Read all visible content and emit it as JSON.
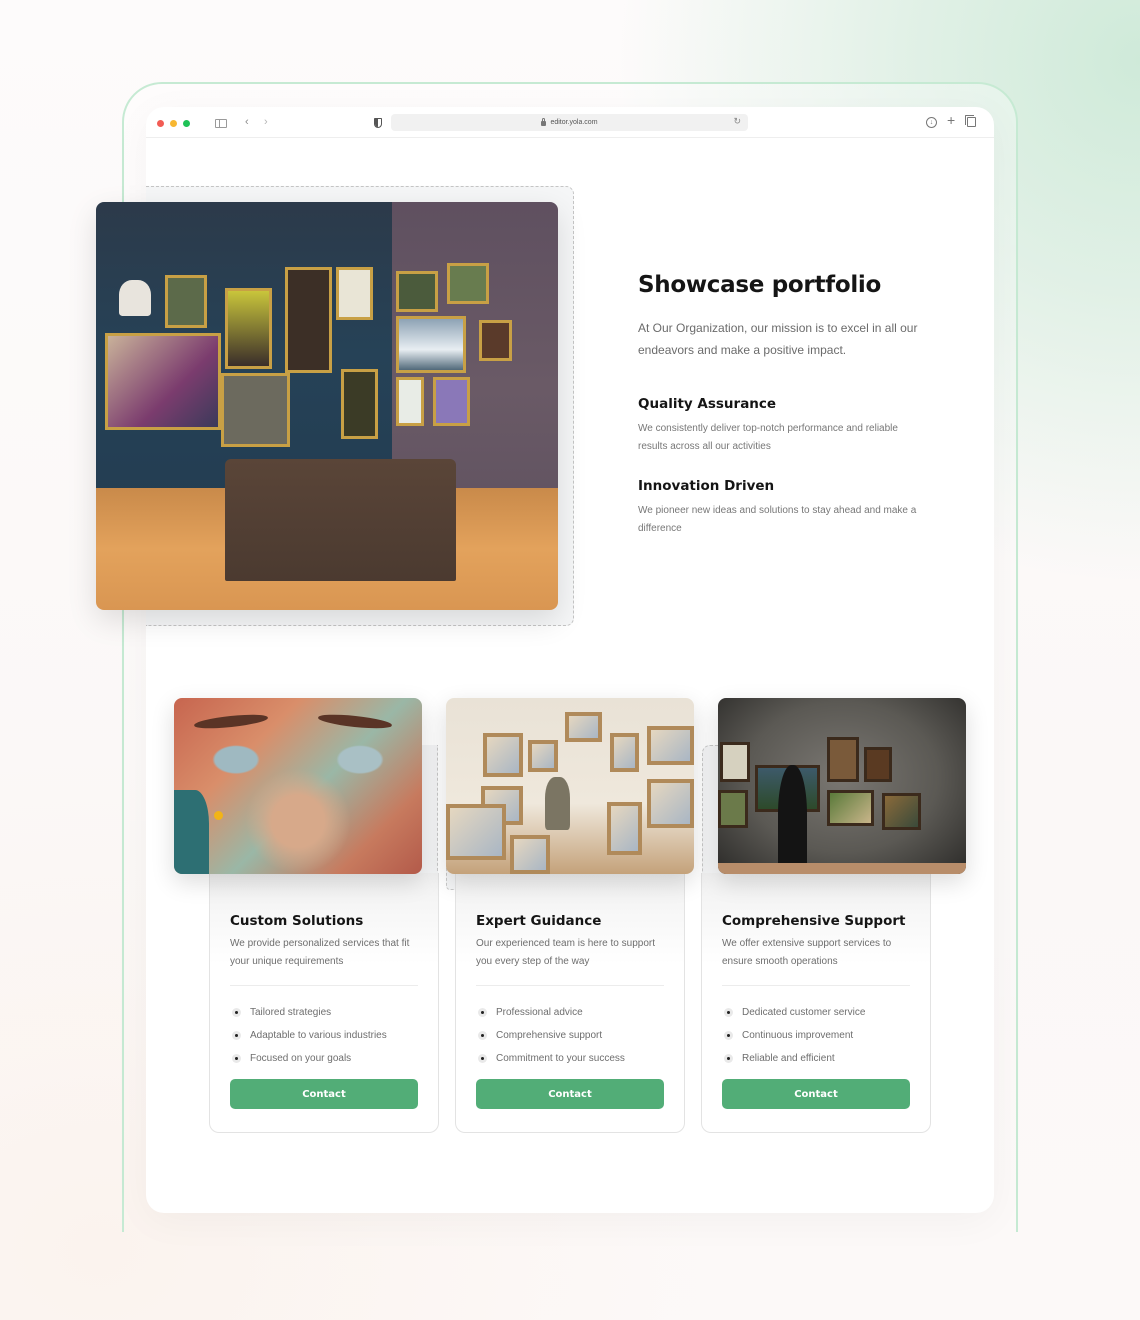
{
  "browser": {
    "url": "editor.yola.com",
    "icons": {
      "sidebar": "sidebar-toggle-icon",
      "back": "chevron-left-icon",
      "forward": "chevron-right-icon",
      "privacy": "shield-icon",
      "lock": "lock-icon",
      "reload": "reload-icon",
      "download": "download-icon",
      "new_tab": "plus-icon",
      "tabs": "tabs-overview-icon"
    },
    "glyphs": {
      "back": "‹",
      "forward": "›",
      "reload": "↻",
      "download": "↓",
      "plus": "+"
    }
  },
  "showcase": {
    "title": "Showcase portfolio",
    "description": "At Our Organization, our mission is to excel in all our endeavors and make a positive impact.",
    "hero_image_alt": "Art gallery room with framed paintings and a leather sofa",
    "features": [
      {
        "title": "Quality Assurance",
        "description": "We consistently deliver top-notch performance and reliable results across all our activities"
      },
      {
        "title": "Innovation Driven",
        "description": "We pioneer new ideas and solutions to stay ahead and make a difference"
      }
    ]
  },
  "services": [
    {
      "title": "Custom Solutions",
      "description": "We provide personalized services that fit your unique requirements",
      "image_alt": "Colorful graffiti mural of a face",
      "bullets": [
        "Tailored strategies",
        "Adaptable to various industries",
        "Focused on your goals"
      ],
      "button_label": "Contact"
    },
    {
      "title": "Expert Guidance",
      "description": "Our experienced team is here to support you every step of the way",
      "image_alt": "Painter working in a studio full of framed paintings",
      "bullets": [
        "Professional advice",
        "Comprehensive support",
        "Commitment to your success"
      ],
      "button_label": "Contact"
    },
    {
      "title": "Comprehensive Support",
      "description": "We offer extensive support services to ensure smooth operations",
      "image_alt": "Person viewing paintings in a gallery",
      "bullets": [
        "Dedicated customer service",
        "Continuous improvement",
        "Reliable and efficient"
      ],
      "button_label": "Contact"
    }
  ],
  "colors": {
    "accent_green": "#52ad77",
    "frame_green": "#c6ead3",
    "heading": "#151515",
    "body_text": "#6e6e6e",
    "traffic_red": "#f25c54",
    "traffic_yellow": "#f7b731",
    "traffic_green": "#1fc257"
  }
}
